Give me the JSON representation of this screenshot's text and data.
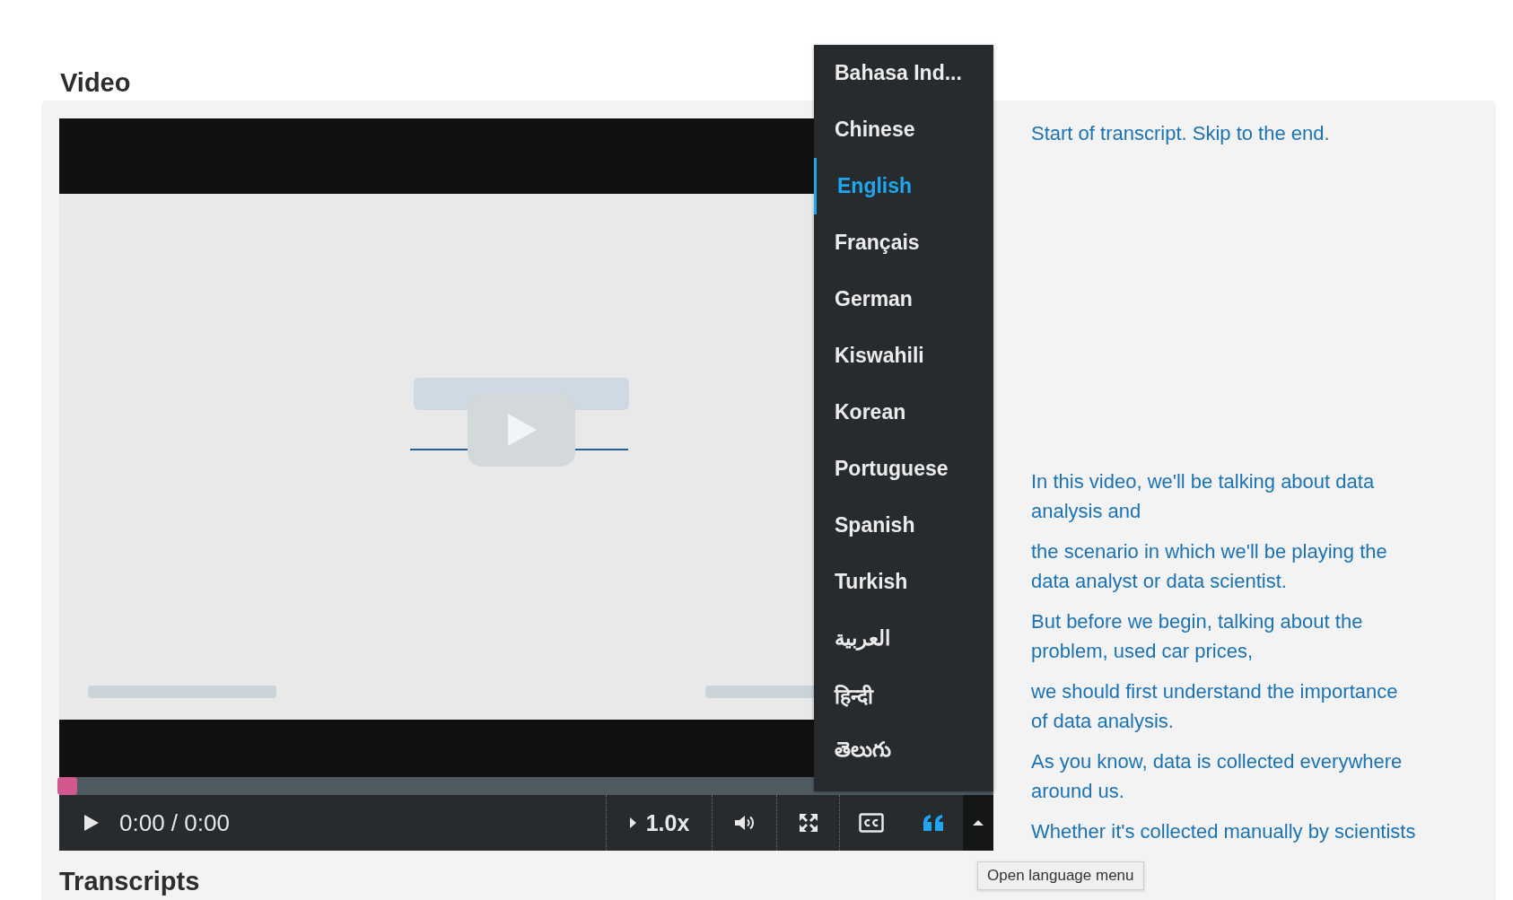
{
  "page_heading": "Video",
  "player": {
    "progress": {
      "level": 0
    },
    "time": "0:00 / 0:00",
    "speed": "1.0x",
    "transcript_on": true,
    "language_menu": {
      "expanded": true,
      "items": [
        {
          "label": "Bahasa Ind...",
          "selected": false
        },
        {
          "label": "Chinese",
          "selected": false
        },
        {
          "label": "English",
          "selected": true
        },
        {
          "label": "Français",
          "selected": false
        },
        {
          "label": "German",
          "selected": false
        },
        {
          "label": "Kiswahili",
          "selected": false
        },
        {
          "label": "Korean",
          "selected": false
        },
        {
          "label": "Portuguese",
          "selected": false
        },
        {
          "label": "Spanish",
          "selected": false
        },
        {
          "label": "Turkish",
          "selected": false
        },
        {
          "label": "العربية",
          "selected": false
        },
        {
          "label": "हिन्दी",
          "selected": false
        },
        {
          "label": "తెలుగు",
          "selected": false
        }
      ]
    },
    "tooltip": "Open language menu"
  },
  "transcript": {
    "skip_link": "Start of transcript. Skip to the end.",
    "paragraphs": [
      "In this video, we'll be talking about data analysis and",
      "the scenario in which we'll be playing the data analyst or data scientist.",
      "But before we begin, talking about the problem, used car prices,",
      "we should first understand the importance of data analysis.",
      "As you know, data is collected everywhere around us.",
      "Whether it's collected manually by scientists"
    ]
  },
  "section_heading": "Transcripts"
}
